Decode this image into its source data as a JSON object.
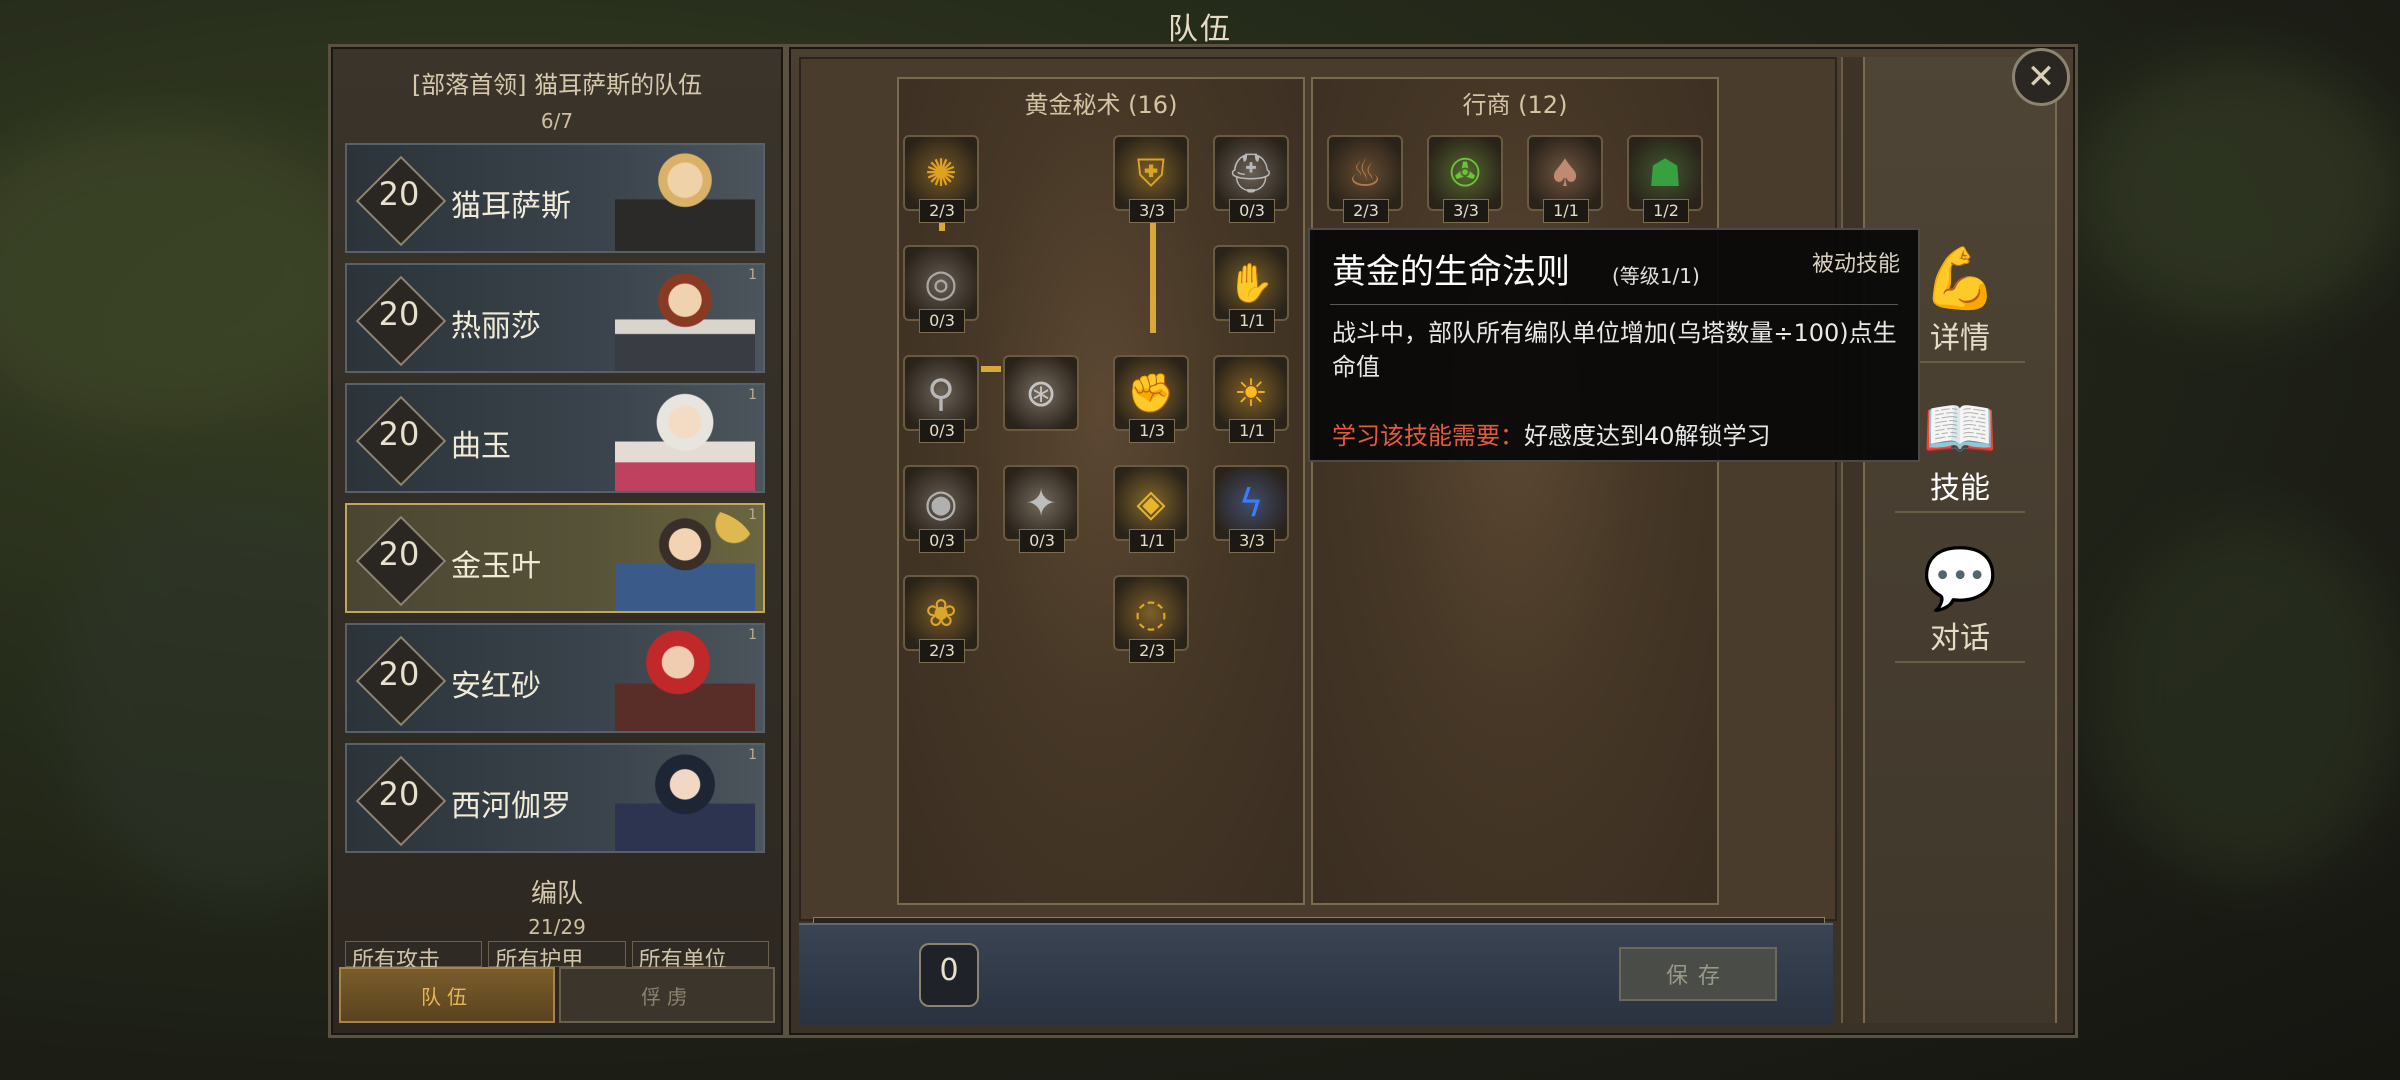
{
  "screen_title": "队伍",
  "party": {
    "header": "[部落首领] 猫耳萨斯的队伍",
    "count": "6/7",
    "units": [
      {
        "level": "20",
        "name": "猫耳萨斯",
        "selected": false,
        "corner": ""
      },
      {
        "level": "20",
        "name": "热丽莎",
        "selected": false,
        "corner": "1"
      },
      {
        "level": "20",
        "name": "曲玉",
        "selected": false,
        "corner": "1"
      },
      {
        "level": "20",
        "name": "金玉叶",
        "selected": true,
        "corner": "1"
      },
      {
        "level": "20",
        "name": "安红砂",
        "selected": false,
        "corner": "1"
      },
      {
        "level": "20",
        "name": "西河伽罗",
        "selected": false,
        "corner": "1"
      }
    ],
    "formation_title": "编队",
    "formation_count": "21/29",
    "filters": [
      "所有攻击",
      "所有护甲",
      "所有单位"
    ],
    "tabs": [
      "队伍",
      "俘虏"
    ]
  },
  "skill_trees": [
    {
      "title": "黄金秘术 (16)",
      "skills": [
        {
          "icon": "golden-swirl-icon",
          "glyph": "✺",
          "level": "2/3",
          "color": "#e0a020"
        },
        {
          "icon": "golden-shield-icon",
          "glyph": "⛨",
          "level": "3/3",
          "color": "#d9a522"
        },
        {
          "icon": "silver-helm-icon",
          "glyph": "⛑",
          "level": "0/3",
          "color": "#b8b8b8"
        },
        {
          "icon": "silver-vortex-icon",
          "glyph": "◎",
          "level": "0/3",
          "color": "#a8a8a8"
        },
        {
          "icon": "golden-hand-icon",
          "glyph": "✋",
          "level": "1/1",
          "color": "#e2b233"
        },
        {
          "icon": "silver-figure-icon",
          "glyph": "⚲",
          "level": "0/3",
          "color": "#b8b8b8"
        },
        {
          "icon": "silver-shield-icon",
          "glyph": "⊛",
          "level": "",
          "color": "#c4c4c4"
        },
        {
          "icon": "golden-fist-icon",
          "glyph": "✊",
          "level": "1/3",
          "color": "#d8a024"
        },
        {
          "icon": "golden-sun-icon",
          "glyph": "☀",
          "level": "1/1",
          "color": "#ffb820"
        },
        {
          "icon": "silver-orb-icon",
          "glyph": "◉",
          "level": "0/3",
          "color": "#b0b0b0"
        },
        {
          "icon": "silver-light-icon",
          "glyph": "✦",
          "level": "0/3",
          "color": "#bdbdbd"
        },
        {
          "icon": "golden-eye-icon",
          "glyph": "◈",
          "level": "1/1",
          "color": "#e6b52a"
        },
        {
          "icon": "blue-lightning-icon",
          "glyph": "ϟ",
          "level": "3/3",
          "color": "#3a7cff"
        },
        {
          "icon": "golden-lotus-icon",
          "glyph": "❀",
          "level": "2/3",
          "color": "#dca628"
        },
        {
          "icon": "golden-tornado-icon",
          "glyph": "◌",
          "level": "2/3",
          "color": "#e0a626"
        }
      ]
    },
    {
      "title": "行商 (12)",
      "skills": [
        {
          "icon": "coin-pouch-icon",
          "glyph": "♨",
          "level": "2/3",
          "color": "#b07a4a"
        },
        {
          "icon": "green-emblem-icon",
          "glyph": "✇",
          "level": "3/3",
          "color": "#6cc43a"
        },
        {
          "icon": "gourd-icon",
          "glyph": "♠",
          "level": "1/1",
          "color": "#c08a70"
        },
        {
          "icon": "green-merchant-icon",
          "glyph": "☗",
          "level": "1/2",
          "color": "#38a040"
        }
      ]
    }
  ],
  "points": "0",
  "save_label": "保存",
  "close_label": "✕",
  "nav": [
    {
      "icon": "strength-arm-icon",
      "glyph": "💪",
      "label": "详情"
    },
    {
      "icon": "skill-book-icon",
      "glyph": "📖",
      "label": "技能"
    },
    {
      "icon": "chat-bubble-icon",
      "glyph": "💬",
      "label": "对话"
    }
  ],
  "tooltip": {
    "title": "黄金的生命法则",
    "level": "(等级1/1)",
    "type": "被动技能",
    "desc": "战斗中，部队所有编队单位增加(乌塔数量÷100)点生命值",
    "req_label": "学习该技能需要：",
    "req_value": "好感度达到40解锁学习"
  }
}
